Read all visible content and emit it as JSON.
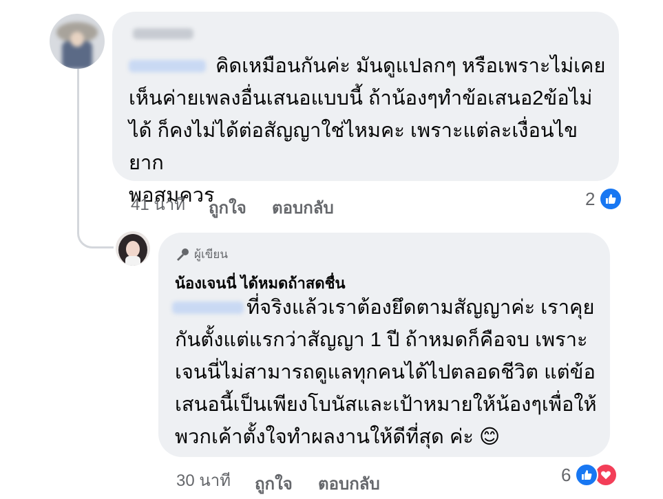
{
  "comment1": {
    "text": "คิดเหมือนกันค่ะ มันดูแปลกๆ หรือเพราะไม่เคย\nเห็นค่ายเพลงอื่นเสนอแบบนี้ ถ้าน้องๆทำข้อเสนอ2ข้อไม่\nได้ ก็คงไม่ได้ต่อสัญญาใช่ไหมคะ เพราะแต่ละเงื่อนไขยาก\nพอสมควร",
    "time": "41 นาที",
    "like_label": "ถูกใจ",
    "reply_label": "ตอบกลับ",
    "reaction_count": "2",
    "reactions": [
      "like-icon"
    ]
  },
  "reply": {
    "badge_label": "ผู้เขียน",
    "author": "น้องเจนนี่ ได้หมดถ้าสดชื่น",
    "text": "ที่จริงแล้วเราต้องยึดตามสัญญาค่ะ เราคุย\nกันตั้งแต่แรกว่าสัญญา 1 ปี ถ้าหมดก็คือจบ เพราะ\nเจนนี่ไม่สามารถดูแลทุกคนได้ไปตลอดชีวิต แต่ข้อ\nเสนอนี้เป็นเพียงโบนัสและเป้าหมายให้น้องๆเพื่อให้\nพวกเค้าตั้งใจทำผลงานให้ดีที่สุด ค่ะ 😊",
    "time": "30 นาที",
    "like_label": "ถูกใจ",
    "reply_label": "ตอบกลับ",
    "reaction_count": "6",
    "reactions": [
      "like-icon",
      "love-icon"
    ]
  },
  "colors": {
    "bubble": "#eef0f3",
    "like_blue": "#1877f2",
    "love_red": "#f33e58",
    "meta_gray": "#65676b"
  }
}
